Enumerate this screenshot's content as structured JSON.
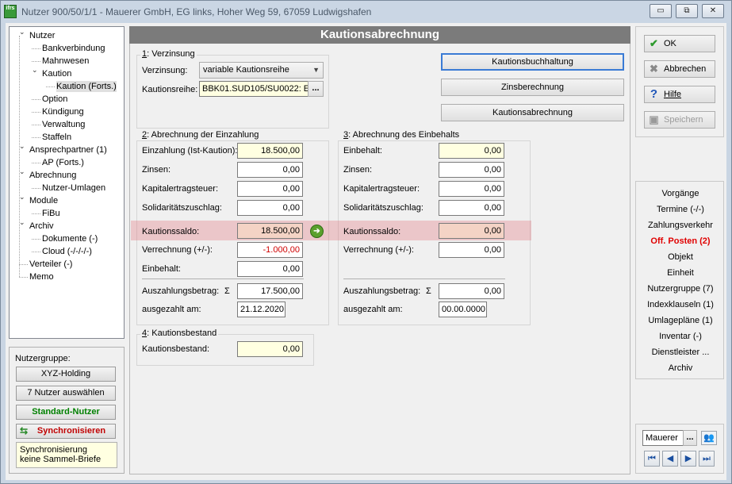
{
  "window": {
    "title": "Nutzer 900/50/1/1 - Mauerer GmbH, EG links, Hoher Weg 59, 67059 Ludwigshafen",
    "icon_label": "ifrs",
    "controls": {
      "minimize": "▭",
      "restore": "⧉",
      "close": "✕"
    }
  },
  "tree": {
    "items": [
      {
        "label": "Nutzer",
        "level": 0,
        "expanded": true
      },
      {
        "label": "Bankverbindung",
        "level": 1
      },
      {
        "label": "Mahnwesen",
        "level": 1
      },
      {
        "label": "Kaution",
        "level": 1,
        "expanded": true
      },
      {
        "label": "Kaution (Forts.)",
        "level": 2,
        "selected": true
      },
      {
        "label": "Option",
        "level": 1
      },
      {
        "label": "Kündigung",
        "level": 1
      },
      {
        "label": "Verwaltung",
        "level": 1
      },
      {
        "label": "Staffeln",
        "level": 1
      },
      {
        "label": "Ansprechpartner (1)",
        "level": 0,
        "expanded": true
      },
      {
        "label": "AP (Forts.)",
        "level": 1
      },
      {
        "label": "Abrechnung",
        "level": 0,
        "expanded": true
      },
      {
        "label": "Nutzer-Umlagen",
        "level": 1
      },
      {
        "label": "Module",
        "level": 0,
        "expanded": true
      },
      {
        "label": "FiBu",
        "level": 1
      },
      {
        "label": "Archiv",
        "level": 0,
        "expanded": true
      },
      {
        "label": "Dokumente (-)",
        "level": 1
      },
      {
        "label": "Cloud (-/-/-/-)",
        "level": 1
      },
      {
        "label": "Verteiler (-)",
        "level": 0
      },
      {
        "label": "Memo",
        "level": 0
      }
    ]
  },
  "nutzergruppe": {
    "label": "Nutzergruppe:",
    "group_button": "XYZ-Holding",
    "select_button": "7 Nutzer auswählen",
    "standard_button": "Standard-Nutzer",
    "sync_button": "Synchronisieren",
    "sync_info_line1": "Synchronisierung",
    "sync_info_line2": "keine Sammel-Briefe"
  },
  "main": {
    "heading": "Kautionsabrechnung",
    "verzinsung": {
      "title_num": "1",
      "title_rest": ": Verzinsung",
      "verzinsung_label": "Verzinsung:",
      "verzinsung_value": "variable Kautionsreihe",
      "reihe_label": "Kautionsreihe:",
      "reihe_value": "BBK01.SUD105/SU0022: E",
      "reihe_button": "..."
    },
    "buttons": {
      "buchhaltung": "Kautionsbuchhaltung",
      "zins": "Zinsberechnung",
      "abrechnung": "Kautionsabrechnung"
    },
    "einzahlung": {
      "title_num": "2",
      "title_rest": ": Abrechnung der Einzahlung",
      "einzahlung_label": "Einzahlung (Ist-Kaution):",
      "einzahlung_value": "18.500,00",
      "zinsen_label": "Zinsen:",
      "zinsen_value": "0,00",
      "kest_label": "Kapitalertragsteuer:",
      "kest_value": "0,00",
      "soli_label": "Solidaritätszuschlag:",
      "soli_value": "0,00",
      "saldo_label": "Kautionssaldo:",
      "saldo_value": "18.500,00",
      "verrechnung_label": "Verrechnung (+/-):",
      "verrechnung_value": "-1.000,00",
      "einbehalt_label": "Einbehalt:",
      "einbehalt_value": "0,00",
      "auszahlung_label": "Auszahlungsbetrag:",
      "sigma": "Σ",
      "auszahlung_value": "17.500,00",
      "ausgezahlt_label": "ausgezahlt am:",
      "ausgezahlt_value": "21.12.2020"
    },
    "einbehalt": {
      "title_num": "3",
      "title_rest": ": Abrechnung des Einbehalts",
      "einbehalt_label": "Einbehalt:",
      "einbehalt_value": "0,00",
      "zinsen_label": "Zinsen:",
      "zinsen_value": "0,00",
      "kest_label": "Kapitalertragsteuer:",
      "kest_value": "0,00",
      "soli_label": "Solidaritätszuschlag:",
      "soli_value": "0,00",
      "saldo_label": "Kautionssaldo:",
      "saldo_value": "0,00",
      "verrechnung_label": "Verrechnung (+/-):",
      "verrechnung_value": "0,00",
      "auszahlung_label": "Auszahlungsbetrag:",
      "sigma": "Σ",
      "auszahlung_value": "0,00",
      "ausgezahlt_label": "ausgezahlt am:",
      "ausgezahlt_value": "00.00.0000"
    },
    "bestand": {
      "title_num": "4",
      "title_rest": ": Kautionsbestand",
      "label": "Kautionsbestand:",
      "value": "0,00"
    }
  },
  "actions": {
    "ok": "OK",
    "abbrechen": "Abbrechen",
    "hilfe": "Hilfe",
    "speichern": "Speichern"
  },
  "nav": {
    "items": [
      {
        "label": "Vorgänge"
      },
      {
        "label": "Termine (-/-)"
      },
      {
        "label": "Zahlungsverkehr"
      },
      {
        "label": "Off. Posten (2)",
        "active": true
      },
      {
        "label": "Objekt"
      },
      {
        "label": "Einheit"
      },
      {
        "label": "Nutzergruppe (7)"
      },
      {
        "label": "Indexklauseln (1)"
      },
      {
        "label": "Umlagepläne (1)"
      },
      {
        "label": "Inventar (-)"
      },
      {
        "label": "Dienstleister ..."
      },
      {
        "label": "Archiv"
      }
    ]
  },
  "user": {
    "name": "Mauerer",
    "browse": "...",
    "first": "⏮",
    "prev": "◀",
    "next": "▶",
    "last": "⏭"
  },
  "colors": {
    "highlight": "#e17882",
    "active_nav": "#e00000",
    "standard_user": "#008000",
    "sync": "#c00000"
  }
}
